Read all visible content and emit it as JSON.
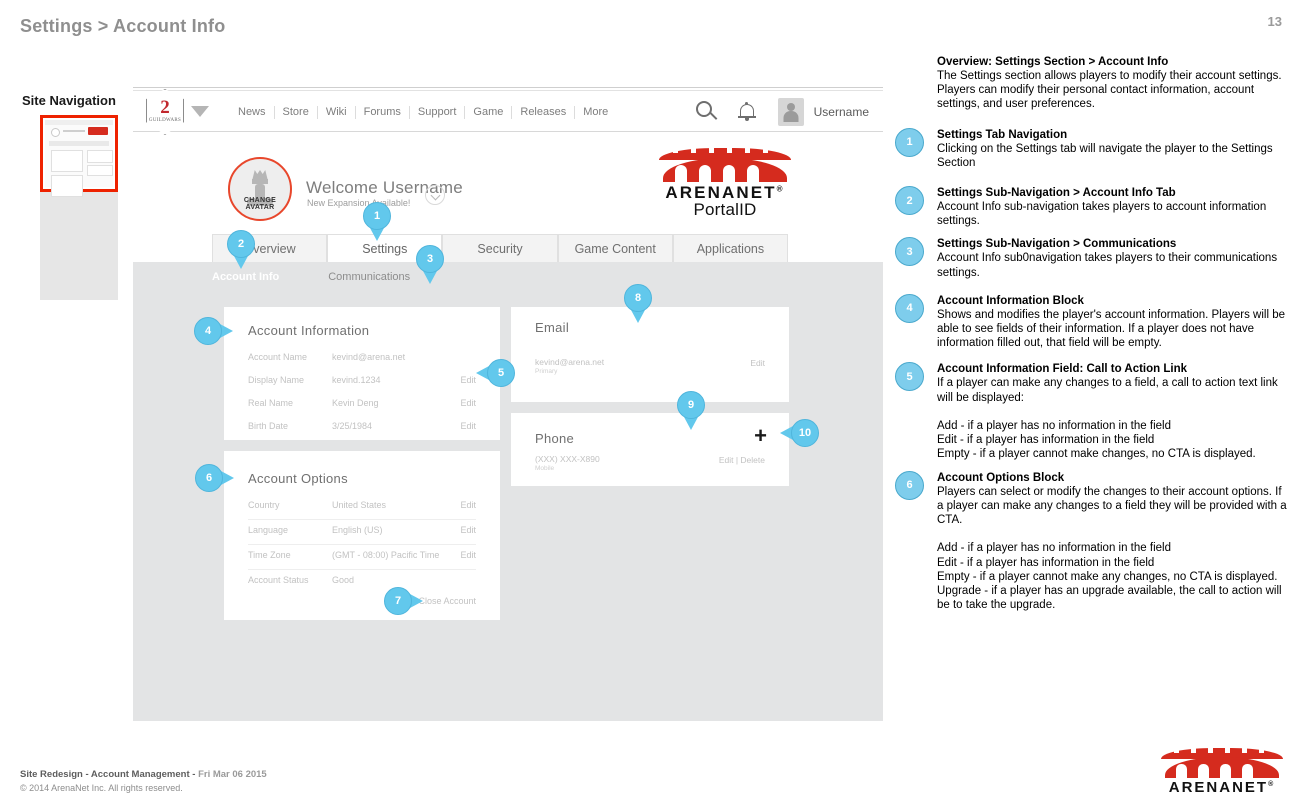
{
  "slide": {
    "title": "Settings > Account Info",
    "page_number": "13"
  },
  "site_navigation": {
    "label": "Site Navigation"
  },
  "global_nav": {
    "links": [
      "News",
      "Store",
      "Wiki",
      "Forums",
      "Support",
      "Game",
      "Releases",
      "More"
    ],
    "username": "Username",
    "icons": [
      "search-icon",
      "bell-icon",
      "avatar-icon"
    ]
  },
  "welcome": {
    "greeting": "Welcome Username",
    "subtext": "New Expansion Available!",
    "avatar_cta": "CHANGE AVATAR"
  },
  "brand": {
    "word": "ARENANET",
    "registered": "®",
    "sub": "PortalID"
  },
  "tabs": [
    {
      "label": "Overview",
      "active": false
    },
    {
      "label": "Settings",
      "active": true
    },
    {
      "label": "Security",
      "active": false
    },
    {
      "label": "Game Content",
      "active": false
    },
    {
      "label": "Applications",
      "active": false
    }
  ],
  "subnav": [
    {
      "label": "Account Info",
      "active": true
    },
    {
      "label": "Communications",
      "active": false
    }
  ],
  "cards": {
    "account_information": {
      "title": "Account Information",
      "rows": [
        {
          "label": "Account Name",
          "value": "kevind@arena.net",
          "cta": ""
        },
        {
          "label": "Display Name",
          "value": "kevind.1234",
          "cta": "Edit"
        },
        {
          "label": "Real Name",
          "value": "Kevin Deng",
          "cta": "Edit"
        },
        {
          "label": "Birth Date",
          "value": "3/25/1984",
          "cta": "Edit"
        }
      ]
    },
    "account_options": {
      "title": "Account Options",
      "rows": [
        {
          "label": "Country",
          "value": "United States",
          "cta": "Edit"
        },
        {
          "label": "Language",
          "value": "English (US)",
          "cta": "Edit"
        },
        {
          "label": "Time Zone",
          "value": "(GMT - 08:00) Pacific Time",
          "cta": "Edit"
        },
        {
          "label": "Account Status",
          "value": "Good",
          "cta": ""
        }
      ],
      "close_account": "Close Account"
    },
    "email": {
      "title": "Email",
      "value": "kevind@arena.net",
      "sub": "Primary",
      "cta": "Edit"
    },
    "phone": {
      "title": "Phone",
      "value": "(XXX) XXX-X890",
      "sub": "Mobile",
      "cta": "Edit | Delete",
      "add_icon": "+"
    }
  },
  "pins": [
    {
      "id": "1",
      "num": "1"
    },
    {
      "id": "2",
      "num": "2"
    },
    {
      "id": "3",
      "num": "3"
    },
    {
      "id": "4",
      "num": "4"
    },
    {
      "id": "5",
      "num": "5"
    },
    {
      "id": "6",
      "num": "6"
    },
    {
      "id": "7",
      "num": "7"
    },
    {
      "id": "8",
      "num": "8"
    },
    {
      "id": "9",
      "num": "9"
    },
    {
      "id": "10",
      "num": "10"
    }
  ],
  "annotations": [
    {
      "num": "",
      "title": "Overview: Settings Section > Account Info",
      "body": "The Settings section allows players to modify their account settings.  Players can modify their personal contact information, account settings, and user preferences."
    },
    {
      "num": "1",
      "title": "Settings Tab Navigation",
      "body": "Clicking on the Settings tab will navigate the player to the Settings Section"
    },
    {
      "num": "2",
      "title": "Settings Sub-Navigation > Account Info Tab",
      "body": "Account Info sub-navigation takes players to account information settings."
    },
    {
      "num": "3",
      "title": "Settings Sub-Navigation > Communications",
      "body": "Account Info sub0navigation takes players to their communications settings."
    },
    {
      "num": "4",
      "title": "Account Information Block",
      "body": "Shows and modifies the player's account information. Players will be able to see fields of their information.  If a player does not have information filled out, that field will be empty."
    },
    {
      "num": "5",
      "title": "Account Information Field: Call to Action Link",
      "body": "If a player can make any changes to a field, a call to action text link will be displayed:\n\nAdd - if a player has no information in the field\nEdit - if a player has information in the field\nEmpty - if a player cannot make changes, no CTA is displayed."
    },
    {
      "num": "6",
      "title": "Account Options Block",
      "body": "Players can select or modify the changes to their account options. If a player can make any changes to a field they will be provided with a CTA.\n\nAdd - if a player has no information in the field\nEdit - if a player has information in the field\nEmpty - if a player cannot make any changes, no CTA is displayed.\nUpgrade - if a player has an upgrade available, the call to action will be to take the upgrade."
    }
  ],
  "footer": {
    "project": "Site Redesign - Account Management - ",
    "date": "Fri Mar 06 2015",
    "copyright": "© 2014 ArenaNet Inc. All rights reserved."
  },
  "colors": {
    "accent": "#62c8ec",
    "brand_red": "#d52b1e",
    "panel_grey": "#e3e4e5",
    "highlight_red": "#ee2200"
  }
}
